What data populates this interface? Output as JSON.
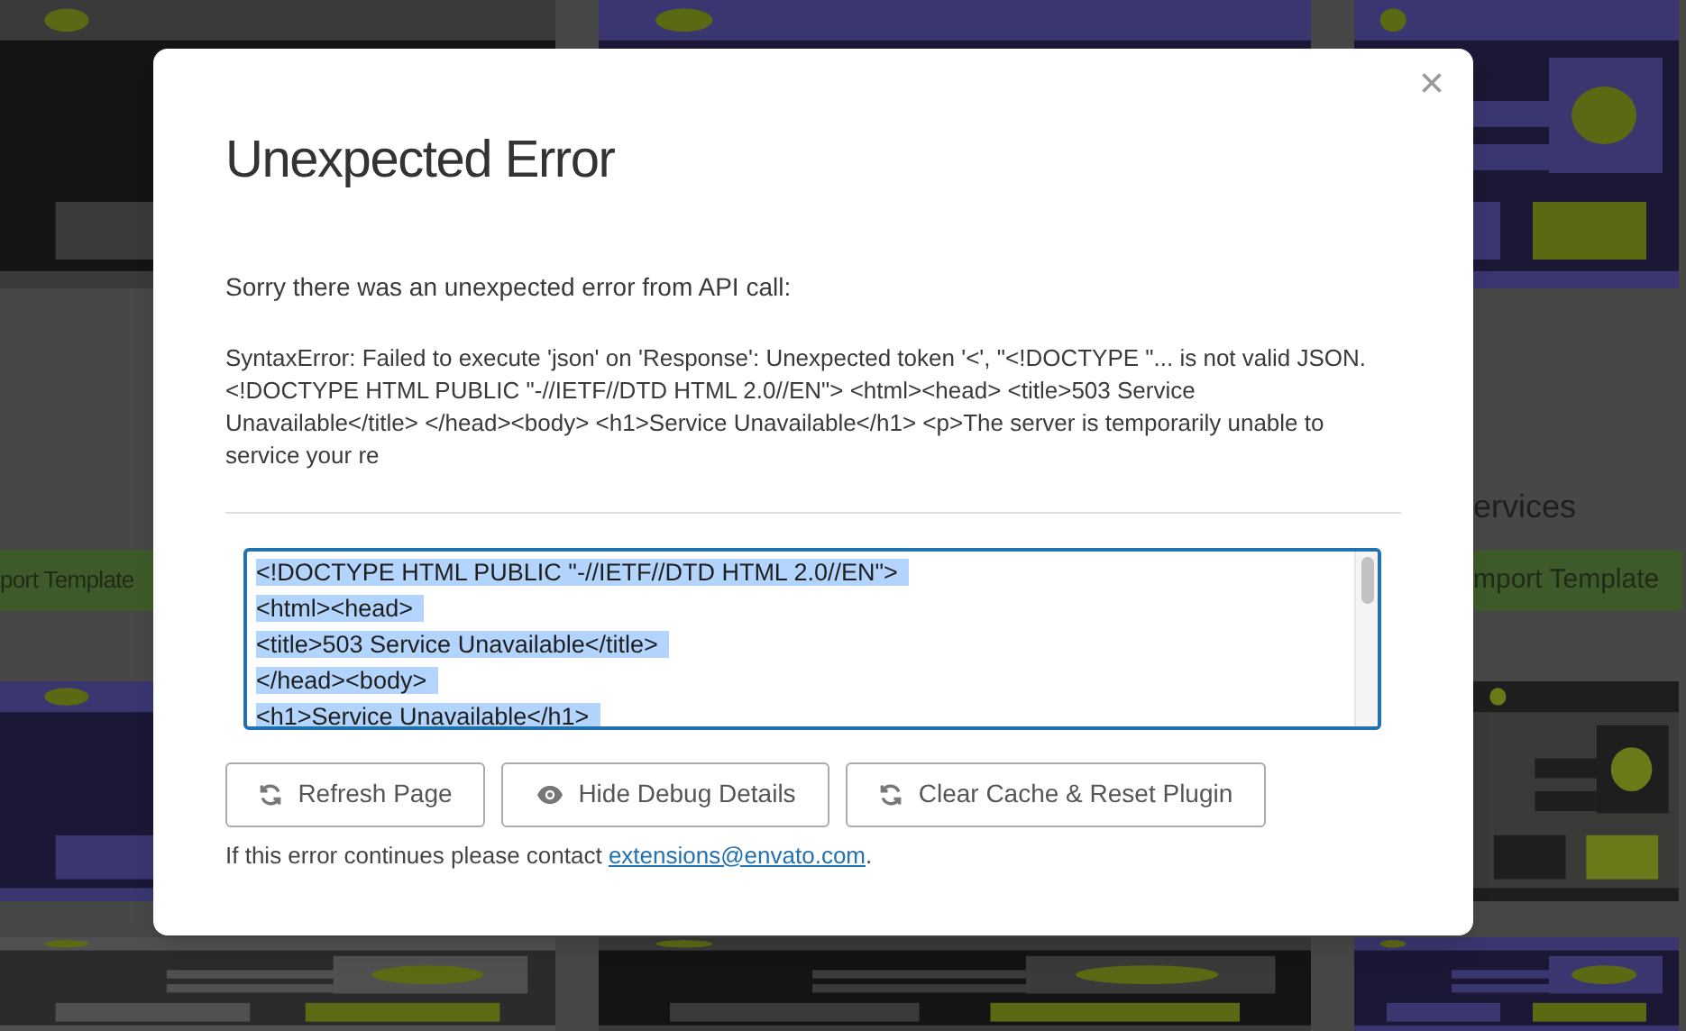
{
  "background": {
    "section_heading": "ervices",
    "import_buttons": [
      "port Template",
      "mport Template"
    ]
  },
  "dialog": {
    "title": "Unexpected Error",
    "close": "×",
    "message": "Sorry there was an unexpected error from API call:",
    "error_detail": "SyntaxError: Failed to execute 'json' on 'Response': Unexpected token '<', \"<!DOCTYPE \"... is not valid JSON. <!DOCTYPE HTML PUBLIC \"-//IETF//DTD HTML 2.0//EN\"> <html><head> <title>503 Service Unavailable</title> </head><body> <h1>Service Unavailable</h1> <p>The server is temporarily unable to service your re",
    "debug_output": {
      "selected": true,
      "lines": [
        "<!DOCTYPE HTML PUBLIC \"-//IETF//DTD HTML 2.0//EN\">",
        "<html><head>",
        "<title>503 Service Unavailable</title>",
        "</head><body>",
        "<h1>Service Unavailable</h1>"
      ]
    },
    "buttons": [
      {
        "label": "Refresh Page",
        "kind": "refresh"
      },
      {
        "label": "Hide Debug Details",
        "kind": "toggle"
      },
      {
        "label": "Clear Cache & Reset Plugin",
        "kind": "refresh"
      }
    ],
    "footer": {
      "text": "If this error continues please contact ",
      "link": "extensions@envato.com",
      "after": "."
    }
  }
}
